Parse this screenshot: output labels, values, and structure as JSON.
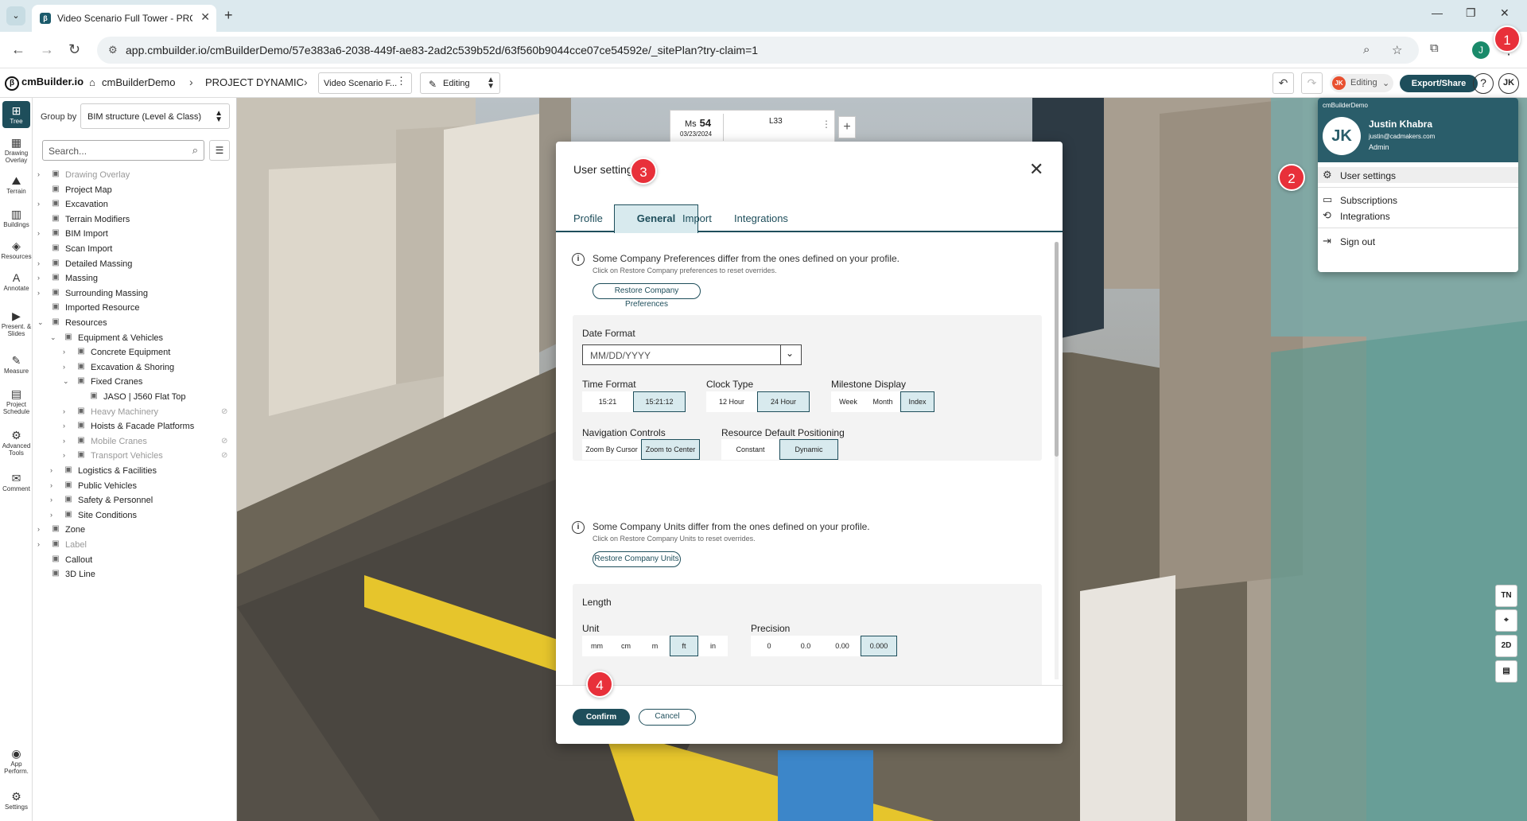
{
  "browser": {
    "tab_title": "Video Scenario Full Tower - PROJECT DYNAMIC",
    "url": "app.cmbuilder.io/cmBuilderDemo/57e383a6-2038-449f-ae83-2ad2c539b52d/63f560b9044cce07ce54592e/_sitePlan?try-claim=1",
    "profile_initial": "J"
  },
  "toolbar": {
    "logo": "cmBuilder.io",
    "org": "cmBuilderDemo",
    "project": "PROJECT DYNAMIC",
    "scenario": "Video Scenario F...",
    "mode": "Editing",
    "editing_badge": "JK",
    "editing_status": "Editing",
    "export": "Export/Share",
    "help": "?",
    "user_initials": "JK"
  },
  "rail": [
    {
      "label": "Tree",
      "icon": "tree-icon"
    },
    {
      "label": "Drawing Overlay",
      "icon": "drawing-icon"
    },
    {
      "label": "Terrain",
      "icon": "terrain-icon"
    },
    {
      "label": "Buildings",
      "icon": "buildings-icon"
    },
    {
      "label": "Resources",
      "icon": "resources-icon"
    },
    {
      "label": "Annotate",
      "icon": "annotate-icon"
    },
    {
      "label": "Present. & Slides",
      "icon": "present-icon"
    },
    {
      "label": "Measure",
      "icon": "measure-icon"
    },
    {
      "label": "Project Schedule",
      "icon": "schedule-icon"
    },
    {
      "label": "Advanced Tools",
      "icon": "tools-icon"
    },
    {
      "label": "Comment",
      "icon": "comment-icon"
    },
    {
      "label": "App Perform.",
      "icon": "performance-icon"
    },
    {
      "label": "Settings",
      "icon": "settings-icon"
    }
  ],
  "panel": {
    "group_by_label": "Group by",
    "group_by_value": "BIM structure (Level & Class)",
    "search_placeholder": "Search...",
    "tree": [
      {
        "label": "Drawing Overlay",
        "depth": 0,
        "expander": ">",
        "muted": true,
        "icon": "overlay-icon"
      },
      {
        "label": "Project Map",
        "depth": 0,
        "expander": "",
        "muted": false,
        "icon": "map-icon"
      },
      {
        "label": "Excavation",
        "depth": 0,
        "expander": ">",
        "muted": false,
        "icon": "excavation-icon"
      },
      {
        "label": "Terrain Modifiers",
        "depth": 0,
        "expander": "",
        "muted": false,
        "icon": "terrain-icon"
      },
      {
        "label": "BIM Import",
        "depth": 0,
        "expander": ">",
        "muted": false,
        "icon": "bim-icon"
      },
      {
        "label": "Scan Import",
        "depth": 0,
        "expander": "",
        "muted": false,
        "icon": "scan-icon"
      },
      {
        "label": "Detailed Massing",
        "depth": 0,
        "expander": ">",
        "muted": false,
        "icon": "massing-icon"
      },
      {
        "label": "Massing",
        "depth": 0,
        "expander": ">",
        "muted": false,
        "icon": "massing-icon"
      },
      {
        "label": "Surrounding Massing",
        "depth": 0,
        "expander": ">",
        "muted": false,
        "icon": "massing-icon"
      },
      {
        "label": "Imported Resource",
        "depth": 0,
        "expander": "",
        "muted": false,
        "icon": "resource-icon"
      },
      {
        "label": "Resources",
        "depth": 0,
        "expander": "v",
        "muted": false,
        "icon": "resources-icon"
      },
      {
        "label": "Equipment & Vehicles",
        "depth": 1,
        "expander": "v",
        "muted": false,
        "icon": "vehicle-icon"
      },
      {
        "label": "Concrete Equipment",
        "depth": 2,
        "expander": ">",
        "muted": false,
        "icon": "concrete-icon"
      },
      {
        "label": "Excavation & Shoring",
        "depth": 2,
        "expander": ">",
        "muted": false,
        "icon": "excavator-icon"
      },
      {
        "label": "Fixed Cranes",
        "depth": 2,
        "expander": "v",
        "muted": false,
        "icon": "crane-icon"
      },
      {
        "label": "JASO | J560 Flat Top",
        "depth": 3,
        "expander": "",
        "muted": false,
        "icon": "crane-model-icon"
      },
      {
        "label": "Heavy Machinery",
        "depth": 2,
        "expander": ">",
        "muted": true,
        "icon": "machinery-icon",
        "hidden": true
      },
      {
        "label": "Hoists & Facade Platforms",
        "depth": 2,
        "expander": ">",
        "muted": false,
        "icon": "hoist-icon"
      },
      {
        "label": "Mobile Cranes",
        "depth": 2,
        "expander": ">",
        "muted": true,
        "icon": "mobile-crane-icon",
        "hidden": true
      },
      {
        "label": "Transport Vehicles",
        "depth": 2,
        "expander": ">",
        "muted": true,
        "icon": "truck-icon",
        "hidden": true
      },
      {
        "label": "Logistics & Facilities",
        "depth": 1,
        "expander": ">",
        "muted": false,
        "icon": "logistics-icon"
      },
      {
        "label": "Public Vehicles",
        "depth": 1,
        "expander": ">",
        "muted": false,
        "icon": "car-icon"
      },
      {
        "label": "Safety & Personnel",
        "depth": 1,
        "expander": ">",
        "muted": false,
        "icon": "safety-icon"
      },
      {
        "label": "Site Conditions",
        "depth": 1,
        "expander": ">",
        "muted": false,
        "icon": "site-icon"
      },
      {
        "label": "Zone",
        "depth": 0,
        "expander": ">",
        "muted": false,
        "icon": "zone-icon"
      },
      {
        "label": "Label",
        "depth": 0,
        "expander": ">",
        "muted": true,
        "icon": "label-icon"
      },
      {
        "label": "Callout",
        "depth": 0,
        "expander": "",
        "muted": false,
        "icon": "callout-icon"
      },
      {
        "label": "3D Line",
        "depth": 0,
        "expander": "",
        "muted": false,
        "icon": "line3d-icon"
      }
    ]
  },
  "timeline": {
    "ms_label": "Ms",
    "ms_number": "54",
    "date": "03/23/2024",
    "level": "L33"
  },
  "modal": {
    "title": "User settings",
    "tabs": [
      "Profile",
      "General",
      "Import",
      "Integrations"
    ],
    "active_tab": "General",
    "pref_note": "Some Company Preferences differ from the ones defined on your profile.",
    "pref_sub": "Click on Restore Company preferences to reset overrides.",
    "restore_pref": "Restore Company Preferences",
    "date_format_label": "Date Format",
    "date_format_value": "MM/DD/YYYY",
    "time_format_label": "Time Format",
    "time_format_options": [
      "15:21",
      "15:21:12"
    ],
    "clock_type_label": "Clock Type",
    "clock_type_options": [
      "12 Hour",
      "24 Hour"
    ],
    "milestone_label": "Milestone Display",
    "milestone_options": [
      "Week",
      "Month",
      "Index"
    ],
    "nav_label": "Navigation Controls",
    "nav_options": [
      "Zoom By Cursor",
      "Zoom to Center"
    ],
    "res_pos_label": "Resource Default Positioning",
    "res_pos_options": [
      "Constant",
      "Dynamic"
    ],
    "units_note": "Some Company Units differ from the ones defined on your profile.",
    "units_sub": "Click on Restore Company Units to reset overrides.",
    "restore_units": "Restore Company Units",
    "length_label": "Length",
    "unit_label": "Unit",
    "unit_options": [
      "mm",
      "cm",
      "m",
      "ft",
      "in"
    ],
    "precision_label": "Precision",
    "precision_options": [
      "0",
      "0.0",
      "0.00",
      "0.000"
    ],
    "confirm": "Confirm",
    "cancel": "Cancel"
  },
  "user_menu": {
    "org": "cmBuilderDemo",
    "initials": "JK",
    "name": "Justin Khabra",
    "email": "justin@cadmakers.com",
    "role": "Admin",
    "items": [
      "User settings",
      "Subscriptions",
      "Integrations",
      "Sign out"
    ]
  },
  "steps": [
    "1",
    "2",
    "3",
    "4"
  ],
  "view_tools": [
    "TN",
    "⌖",
    "2D",
    "▤"
  ],
  "colors": {
    "accent": "#1e4e5b",
    "accent_light": "#d8eaee",
    "step_red": "#e8303a",
    "menu_header": "#2a5d6a"
  }
}
